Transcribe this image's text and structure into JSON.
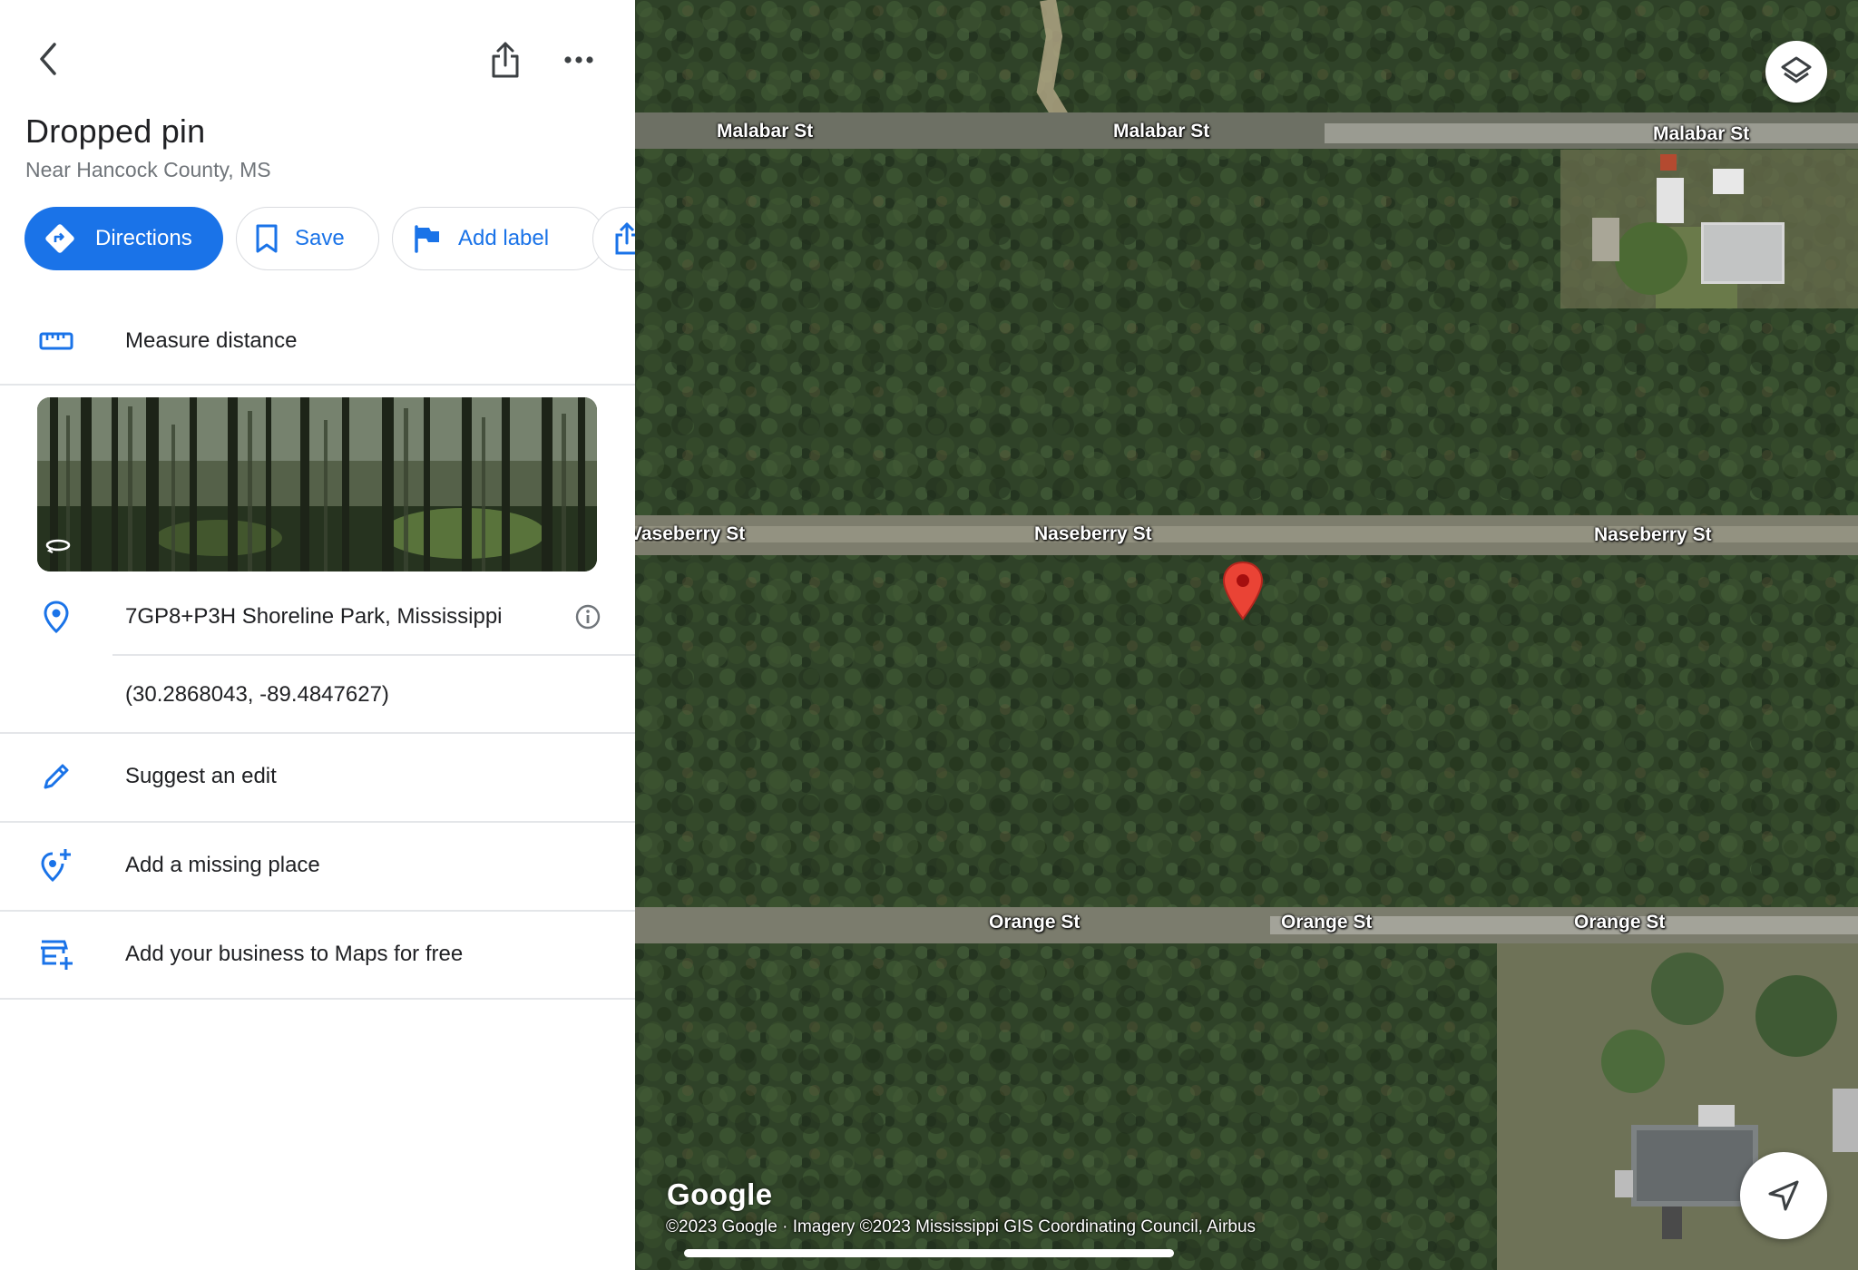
{
  "place": {
    "title": "Dropped pin",
    "subtitle": "Near Hancock County, MS"
  },
  "actions": {
    "directions": "Directions",
    "save": "Save",
    "add_label": "Add label"
  },
  "rows": {
    "measure": "Measure distance",
    "plus_code": "7GP8+P3H Shoreline Park, Mississippi",
    "coordinates": "(30.2868043, -89.4847627)",
    "suggest_edit": "Suggest an edit",
    "add_missing": "Add a missing place",
    "add_business": "Add your business to Maps for free"
  },
  "map": {
    "streets": {
      "malabar": "Malabar St",
      "naseberry": "Naseberry St",
      "naseberry_cut": "Vaseberry St",
      "orange": "Orange St"
    },
    "logo": "Google",
    "attribution": "©2023 Google · Imagery ©2023 Mississippi GIS Coordinating Council, Airbus",
    "pin_color": "#ea4335"
  },
  "colors": {
    "accent": "#1a73e8",
    "text_primary": "#202124",
    "text_secondary": "#70757a"
  }
}
